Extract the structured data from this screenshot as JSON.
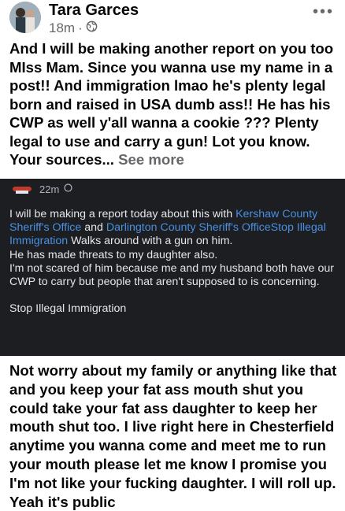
{
  "post": {
    "author": "Tara Garces",
    "time": "18m",
    "body": "And I will be making another report on you too MIss Mam. Since you wanna use my name in a post!! And immigration lmao he's plenty legal born and raised in USA dumb ass!! He has his CWP as well y'all wanna a cookie ??? Plenty legal to use and carry a gun! Lot you know. Your sources...",
    "see_more": "See more"
  },
  "screenshot": {
    "time": "22m",
    "line1_a": "I will be making a report today about this with ",
    "link1": "Kershaw County Sheriff's Office",
    "line1_b": " and ",
    "link2": "Darlington County Sheriff's OfficeStop Illegal Immigration",
    "line1_c": " Walks around with a gun on him.",
    "line2": "He has made threats to my daughter also.",
    "line3": "I'm not scared of him because me and my husband both have our CWP to carry but people that aren't supposed to is concerning.",
    "line4": "Stop Illegal Immigration"
  },
  "lower": {
    "body": "Not worry about my family or anything like that and you keep your fat ass mouth shut you could take your fat ass daughter to keep her mouth shut too. I live right here in Chesterfield anytime you wanna come and meet me to run your mouth please let me know I promise you I'm not like your fucking daughter. I will roll up. Yeah it's public"
  }
}
